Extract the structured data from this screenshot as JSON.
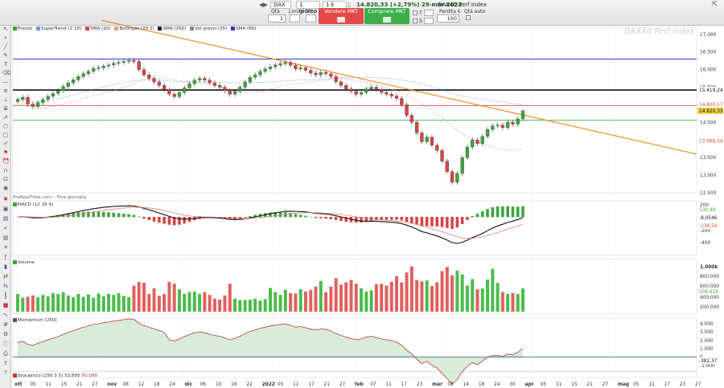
{
  "topbar": {
    "instrument": "DAX",
    "timeframe": "1 giorno",
    "units": "1 k unità",
    "price_info": "14.820,33 (+2,79%) 29-mar-2022",
    "title": "DAX40 Perf Index",
    "qty_label": "Qtà",
    "qty_value": "1",
    "limit_label": "Limite",
    "stop_label": "Stop",
    "sell_label": "Vendere MKT",
    "buy_label": "Comprare MKT",
    "loss_label": "Perdita €",
    "loss_value": "100",
    "auto_label": "Qtà auto",
    "t_label": "T",
    "s_label": "S",
    "t_value": "",
    "s_value": ""
  },
  "watermark": "DAX40 Perf Index",
  "legend_price": [
    "Prezzo",
    "SuperTrend (2 10)",
    "SMA (20)",
    "Bollinger (20 2)",
    "SMA (250)",
    "Vol prezzi (25)",
    "SMA (60)"
  ],
  "legend_colors": [
    "#3fa33f",
    "#6a9ad8",
    "#d64545",
    "#e59898",
    "#222222",
    "#8a8a8a",
    "#2a3bd0"
  ],
  "source_label": "ProRealTime.com – Fine giornata",
  "panels": {
    "macd": {
      "label": "MACD (12 26 9)",
      "ticks": [
        "200",
        "0",
        "-200",
        "-400"
      ],
      "value_up": "130,49",
      "value_mid": "-8,0546",
      "value_down": "-138,54"
    },
    "volume": {
      "label": "Volume",
      "ticks": [
        "1.000k",
        "800.000",
        "600.000",
        "400.000",
        "200.000"
      ],
      "value": "509.618"
    },
    "momentum": {
      "label": "Momentum (250)",
      "ticks": [
        "4.000",
        "3.000",
        "2.000",
        "1.000",
        "0",
        "-1.000"
      ],
      "value": "-382,37"
    },
    "stoch": {
      "label": "Stocastico (250 3 5)",
      "value": "53,895",
      "value2": "50,088"
    }
  },
  "price_axis": {
    "ticks": [
      "17.000",
      "16.500",
      "16.000",
      "15.500",
      "15.000",
      "14.500",
      "14.000",
      "13.500",
      "13.000",
      "12.500"
    ],
    "last_price": "14.820,33",
    "sma250": "15.419,24",
    "boll_up": "14.800,17",
    "boll_low": "13.968,34"
  },
  "hlines": {
    "blue_high": 16300,
    "black_mid": 15419,
    "red": 14980,
    "green": 14560
  },
  "trendline": {
    "start": [
      0,
      17400
    ],
    "end": [
      1,
      13600
    ]
  },
  "time_axis": [
    "ott",
    "05",
    "11",
    "15",
    "21",
    "27",
    "nov",
    "08",
    "12",
    "18",
    "24",
    "dic",
    "06",
    "10",
    "16",
    "22",
    "2022",
    "05",
    "11",
    "17",
    "21",
    "27",
    "feb",
    "07",
    "11",
    "17",
    "23",
    "mar",
    "08",
    "14",
    "18",
    "24",
    "30",
    "apr",
    "05",
    "11",
    "15",
    "21",
    "27",
    "mag",
    "05",
    "11",
    "17",
    "23",
    "27"
  ],
  "chart_data": {
    "type": "candlestick",
    "close": [
      15150,
      15210,
      15020,
      14950,
      15060,
      15150,
      15240,
      15320,
      15400,
      15520,
      15620,
      15710,
      15800,
      15880,
      15950,
      16030,
      16050,
      16100,
      16130,
      16180,
      16200,
      16230,
      16260,
      16230,
      16000,
      15850,
      15750,
      15650,
      15550,
      15430,
      15300,
      15230,
      15350,
      15480,
      15600,
      15700,
      15750,
      15700,
      15620,
      15550,
      15500,
      15400,
      15300,
      15380,
      15500,
      15650,
      15780,
      15850,
      15950,
      16020,
      16080,
      16130,
      16170,
      16200,
      16120,
      16020,
      16050,
      15980,
      15900,
      15850,
      15920,
      15880,
      15800,
      15650,
      15550,
      15450,
      15380,
      15300,
      15350,
      15450,
      15500,
      15430,
      15350,
      15300,
      15250,
      15180,
      15000,
      14700,
      14500,
      14200,
      13950,
      14080,
      13850,
      13700,
      13400,
      13100,
      12800,
      13050,
      13500,
      13800,
      14000,
      13900,
      14100,
      14300,
      14400,
      14420,
      14350,
      14500,
      14450,
      14600,
      14820
    ],
    "volume": [
      380000,
      300000,
      320000,
      350000,
      310000,
      360000,
      330000,
      400000,
      380000,
      420000,
      350000,
      310000,
      380000,
      320000,
      370000,
      300000,
      390000,
      330000,
      380000,
      360000,
      400000,
      340000,
      310000,
      560000,
      640000,
      620000,
      380000,
      500000,
      340000,
      380000,
      640000,
      600000,
      480000,
      380000,
      420000,
      430000,
      380000,
      420000,
      360000,
      280000,
      260000,
      350000,
      600000,
      280000,
      250000,
      250000,
      260000,
      280000,
      240000,
      270000,
      510000,
      420000,
      360000,
      470000,
      400000,
      390000,
      480000,
      430000,
      470000,
      540000,
      660000,
      420000,
      540000,
      720000,
      580000,
      630000,
      680000,
      600000,
      500000,
      430000,
      460000,
      590000,
      600000,
      560000,
      640000,
      760000,
      630000,
      840000,
      970000,
      680000,
      650000,
      670000,
      550000,
      630000,
      870000,
      960000,
      780000,
      880000,
      800000,
      560000,
      700000,
      480000,
      500000,
      690000,
      920000,
      620000,
      420000,
      380000,
      400000,
      380000,
      500000
    ],
    "ylim": [
      12500,
      17200
    ]
  }
}
